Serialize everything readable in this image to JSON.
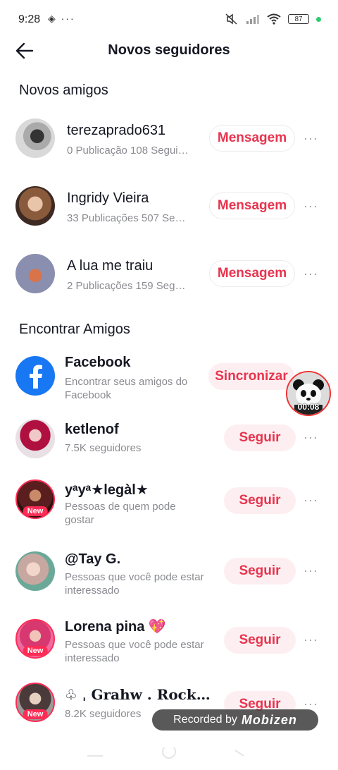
{
  "status_bar": {
    "time": "9:28",
    "left_icons": "◈ ···",
    "battery": "87",
    "accent_green": "#2ecc71"
  },
  "header": {
    "title": "Novos seguidores",
    "back_icon": "arrow-left-icon"
  },
  "sections": {
    "new_friends_title": "Novos amigos",
    "find_friends_title": "Encontrar Amigos"
  },
  "new_friends": [
    {
      "name": "terezaprado631",
      "sub": "0 Publicação 108 Segui…",
      "button": "Mensagem"
    },
    {
      "name": "Ingridy Vieira",
      "sub": "33 Publicações 507 Se…",
      "button": "Mensagem"
    },
    {
      "name": "A lua me traiu",
      "sub": "2 Publicações 159 Seg…",
      "button": "Mensagem"
    }
  ],
  "facebook": {
    "name": "Facebook",
    "sub": "Encontrar seus amigos do Facebook",
    "button": "Sincronizar"
  },
  "suggestions": [
    {
      "name": "ketlenof",
      "sub": "7.5K seguidores",
      "button": "Seguir",
      "badge": ""
    },
    {
      "name": "yᵃyᵃ★legàl★",
      "sub": "Pessoas de quem pode gostar",
      "button": "Seguir",
      "badge": "New"
    },
    {
      "name": "@Tay G.",
      "sub": "Pessoas que você pode estar interessado",
      "button": "Seguir",
      "badge": ""
    },
    {
      "name": "Lorena pina 💖",
      "sub": "Pessoas que você pode estar interessado",
      "button": "Seguir",
      "badge": "New"
    },
    {
      "name": "♧ ˌ 𝐆𝐫𝐚𝐡𝐰 . 𝐑𝐨𝐜𝐤…",
      "sub": "8.2K seguidores",
      "button": "Seguir",
      "badge": "New"
    }
  ],
  "more_icon": "···",
  "floating_video": {
    "time": "00:08"
  },
  "recording_banner": {
    "text": "Recorded by",
    "brand": "Mobizen"
  },
  "colors": {
    "accent": "#e8344e",
    "button_fill": "#fdeff1",
    "facebook_blue": "#1877f2"
  }
}
